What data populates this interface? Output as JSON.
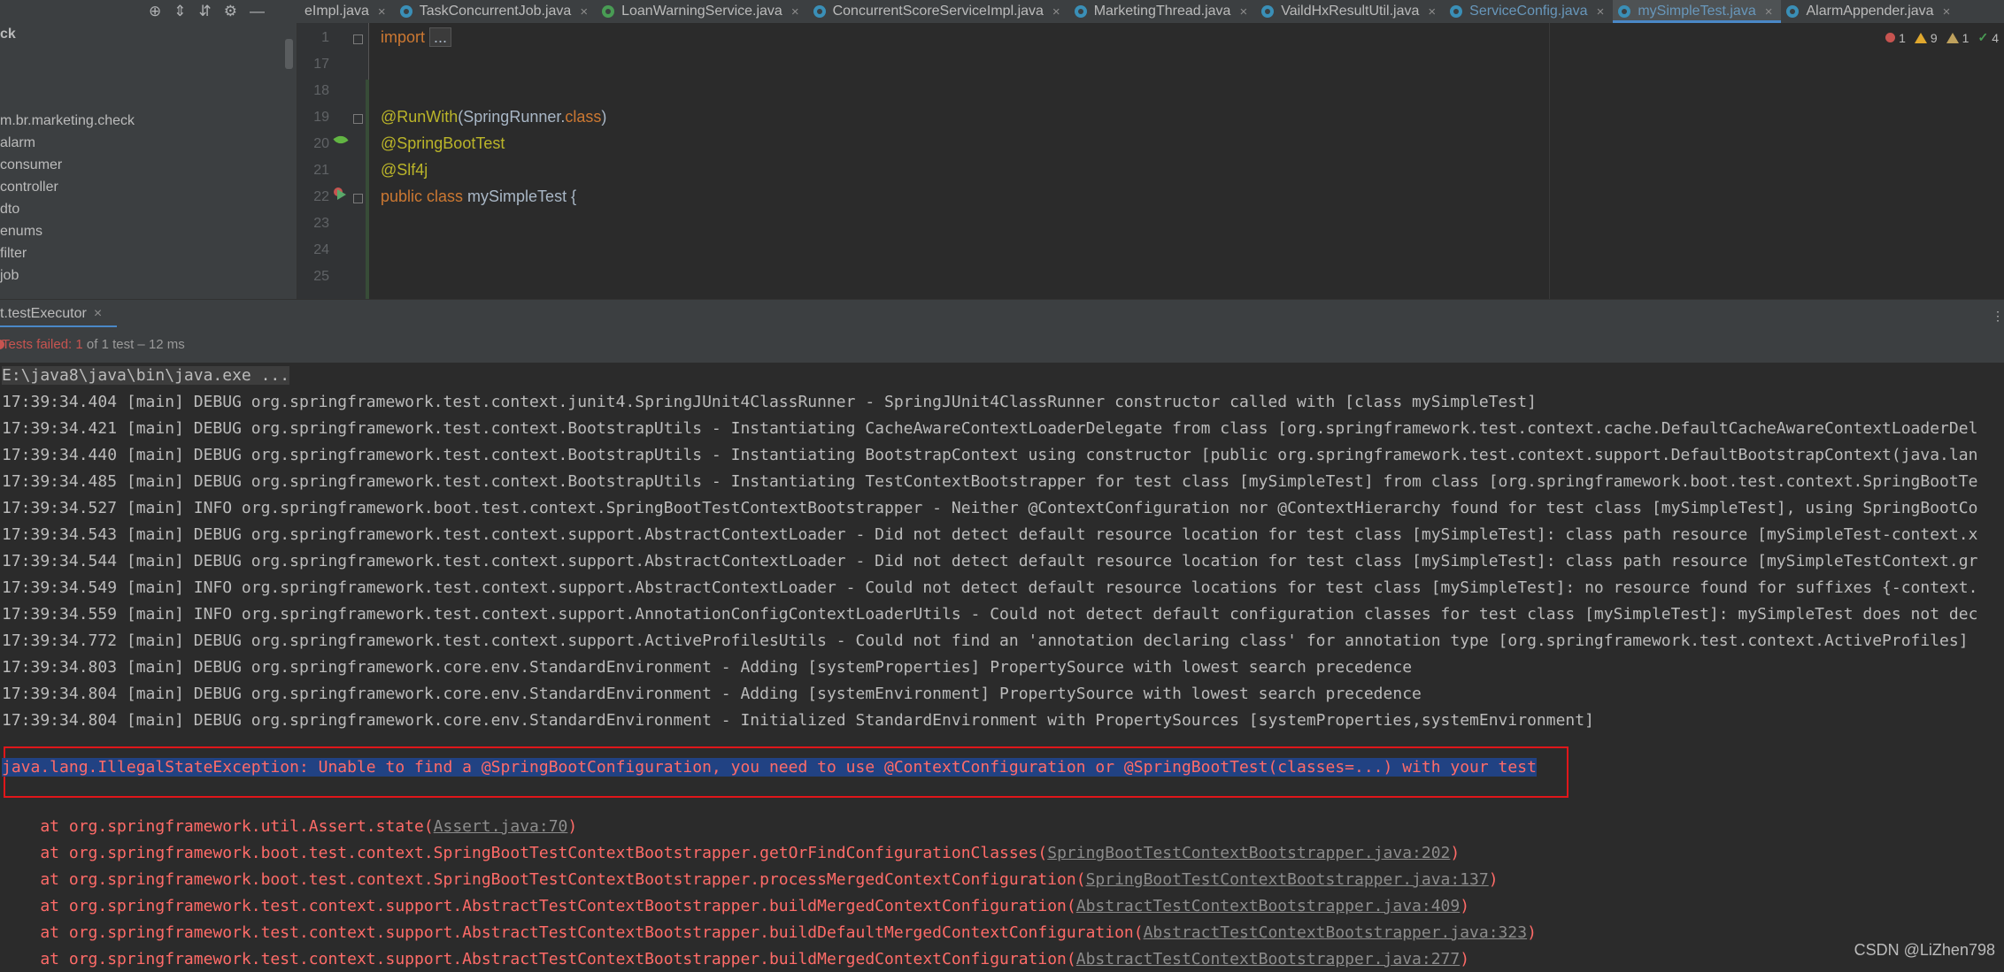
{
  "tabbar": {
    "tool_icons": [
      "target-icon",
      "expand-all-icon",
      "collapse-all-icon",
      "gear-icon",
      "minimize-icon"
    ],
    "tabs": [
      {
        "label": "eImpl.java",
        "icon": "",
        "state": "normal"
      },
      {
        "label": "TaskConcurrentJob.java",
        "icon": "class",
        "state": "normal"
      },
      {
        "label": "LoanWarningService.java",
        "icon": "interface",
        "state": "normal"
      },
      {
        "label": "ConcurrentScoreServiceImpl.java",
        "icon": "class",
        "state": "normal"
      },
      {
        "label": "MarketingThread.java",
        "icon": "class",
        "state": "normal"
      },
      {
        "label": "VaildHxResultUtil.java",
        "icon": "class",
        "state": "normal"
      },
      {
        "label": "ServiceConfig.java",
        "icon": "class",
        "state": "modified"
      },
      {
        "label": "mySimpleTest.java",
        "icon": "class",
        "state": "active"
      },
      {
        "label": "AlarmAppender.java",
        "icon": "class",
        "state": "normal"
      }
    ]
  },
  "sidebar": {
    "header": "ck",
    "items": [
      "m.br.marketing.check",
      "alarm",
      "consumer",
      "controller",
      "dto",
      "enums",
      "filter",
      "job"
    ]
  },
  "editor": {
    "lines": [
      {
        "num": "1",
        "text": "import ..."
      },
      {
        "num": "17",
        "text": ""
      },
      {
        "num": "18",
        "text": ""
      },
      {
        "num": "19",
        "text": "@RunWith(SpringRunner.class)"
      },
      {
        "num": "20",
        "text": "@SpringBootTest"
      },
      {
        "num": "21",
        "text": "@Slf4j"
      },
      {
        "num": "22",
        "text": "public class mySimpleTest {"
      },
      {
        "num": "23",
        "text": ""
      },
      {
        "num": "24",
        "text": ""
      },
      {
        "num": "25",
        "text": ""
      }
    ],
    "inspections": {
      "errors": "1",
      "warnings": "9",
      "weak_warnings": "1",
      "ok": "4"
    }
  },
  "run": {
    "tab_label": "t.testExecutor",
    "status": {
      "prefix": "Tests failed: ",
      "count": "1",
      "detail": " of 1 test",
      "dash": " – ",
      "duration": "12 ms"
    }
  },
  "console": {
    "command": "E:\\java8\\java\\bin\\java.exe ...",
    "log_lines": [
      "17:39:34.404 [main] DEBUG org.springframework.test.context.junit4.SpringJUnit4ClassRunner - SpringJUnit4ClassRunner constructor called with [class mySimpleTest]",
      "17:39:34.421 [main] DEBUG org.springframework.test.context.BootstrapUtils - Instantiating CacheAwareContextLoaderDelegate from class [org.springframework.test.context.cache.DefaultCacheAwareContextLoaderDel",
      "17:39:34.440 [main] DEBUG org.springframework.test.context.BootstrapUtils - Instantiating BootstrapContext using constructor [public org.springframework.test.context.support.DefaultBootstrapContext(java.lan",
      "17:39:34.485 [main] DEBUG org.springframework.test.context.BootstrapUtils - Instantiating TestContextBootstrapper for test class [mySimpleTest] from class [org.springframework.boot.test.context.SpringBootTe",
      "17:39:34.527 [main] INFO org.springframework.boot.test.context.SpringBootTestContextBootstrapper - Neither @ContextConfiguration nor @ContextHierarchy found for test class [mySimpleTest], using SpringBootCo",
      "17:39:34.543 [main] DEBUG org.springframework.test.context.support.AbstractContextLoader - Did not detect default resource location for test class [mySimpleTest]: class path resource [mySimpleTest-context.x",
      "17:39:34.544 [main] DEBUG org.springframework.test.context.support.AbstractContextLoader - Did not detect default resource location for test class [mySimpleTest]: class path resource [mySimpleTestContext.gr",
      "17:39:34.549 [main] INFO org.springframework.test.context.support.AbstractContextLoader - Could not detect default resource locations for test class [mySimpleTest]: no resource found for suffixes {-context.",
      "17:39:34.559 [main] INFO org.springframework.test.context.support.AnnotationConfigContextLoaderUtils - Could not detect default configuration classes for test class [mySimpleTest]: mySimpleTest does not dec",
      "17:39:34.772 [main] DEBUG org.springframework.test.context.support.ActiveProfilesUtils - Could not find an 'annotation declaring class' for annotation type [org.springframework.test.context.ActiveProfiles]",
      "17:39:34.803 [main] DEBUG org.springframework.core.env.StandardEnvironment - Adding [systemProperties] PropertySource with lowest search precedence",
      "17:39:34.804 [main] DEBUG org.springframework.core.env.StandardEnvironment - Adding [systemEnvironment] PropertySource with lowest search precedence",
      "17:39:34.804 [main] DEBUG org.springframework.core.env.StandardEnvironment - Initialized StandardEnvironment with PropertySources [systemProperties,systemEnvironment]"
    ],
    "exception": "java.lang.IllegalStateException: Unable to find a @SpringBootConfiguration, you need to use @ContextConfiguration or @SpringBootTest(classes=...) with your test",
    "stack": [
      {
        "text": "    at org.springframework.util.Assert.state(",
        "link": "Assert.java:70",
        "close": ")"
      },
      {
        "text": "    at org.springframework.boot.test.context.SpringBootTestContextBootstrapper.getOrFindConfigurationClasses(",
        "link": "SpringBootTestContextBootstrapper.java:202",
        "close": ")"
      },
      {
        "text": "    at org.springframework.boot.test.context.SpringBootTestContextBootstrapper.processMergedContextConfiguration(",
        "link": "SpringBootTestContextBootstrapper.java:137",
        "close": ")"
      },
      {
        "text": "    at org.springframework.test.context.support.AbstractTestContextBootstrapper.buildMergedContextConfiguration(",
        "link": "AbstractTestContextBootstrapper.java:409",
        "close": ")"
      },
      {
        "text": "    at org.springframework.test.context.support.AbstractTestContextBootstrapper.buildDefaultMergedContextConfiguration(",
        "link": "AbstractTestContextBootstrapper.java:323",
        "close": ")"
      },
      {
        "text": "    at org.springframework.test.context.support.AbstractTestContextBootstrapper.buildMergedContextConfiguration(",
        "link": "AbstractTestContextBootstrapper.java:277",
        "close": ")"
      }
    ]
  },
  "watermark": "CSDN @LiZhen798"
}
